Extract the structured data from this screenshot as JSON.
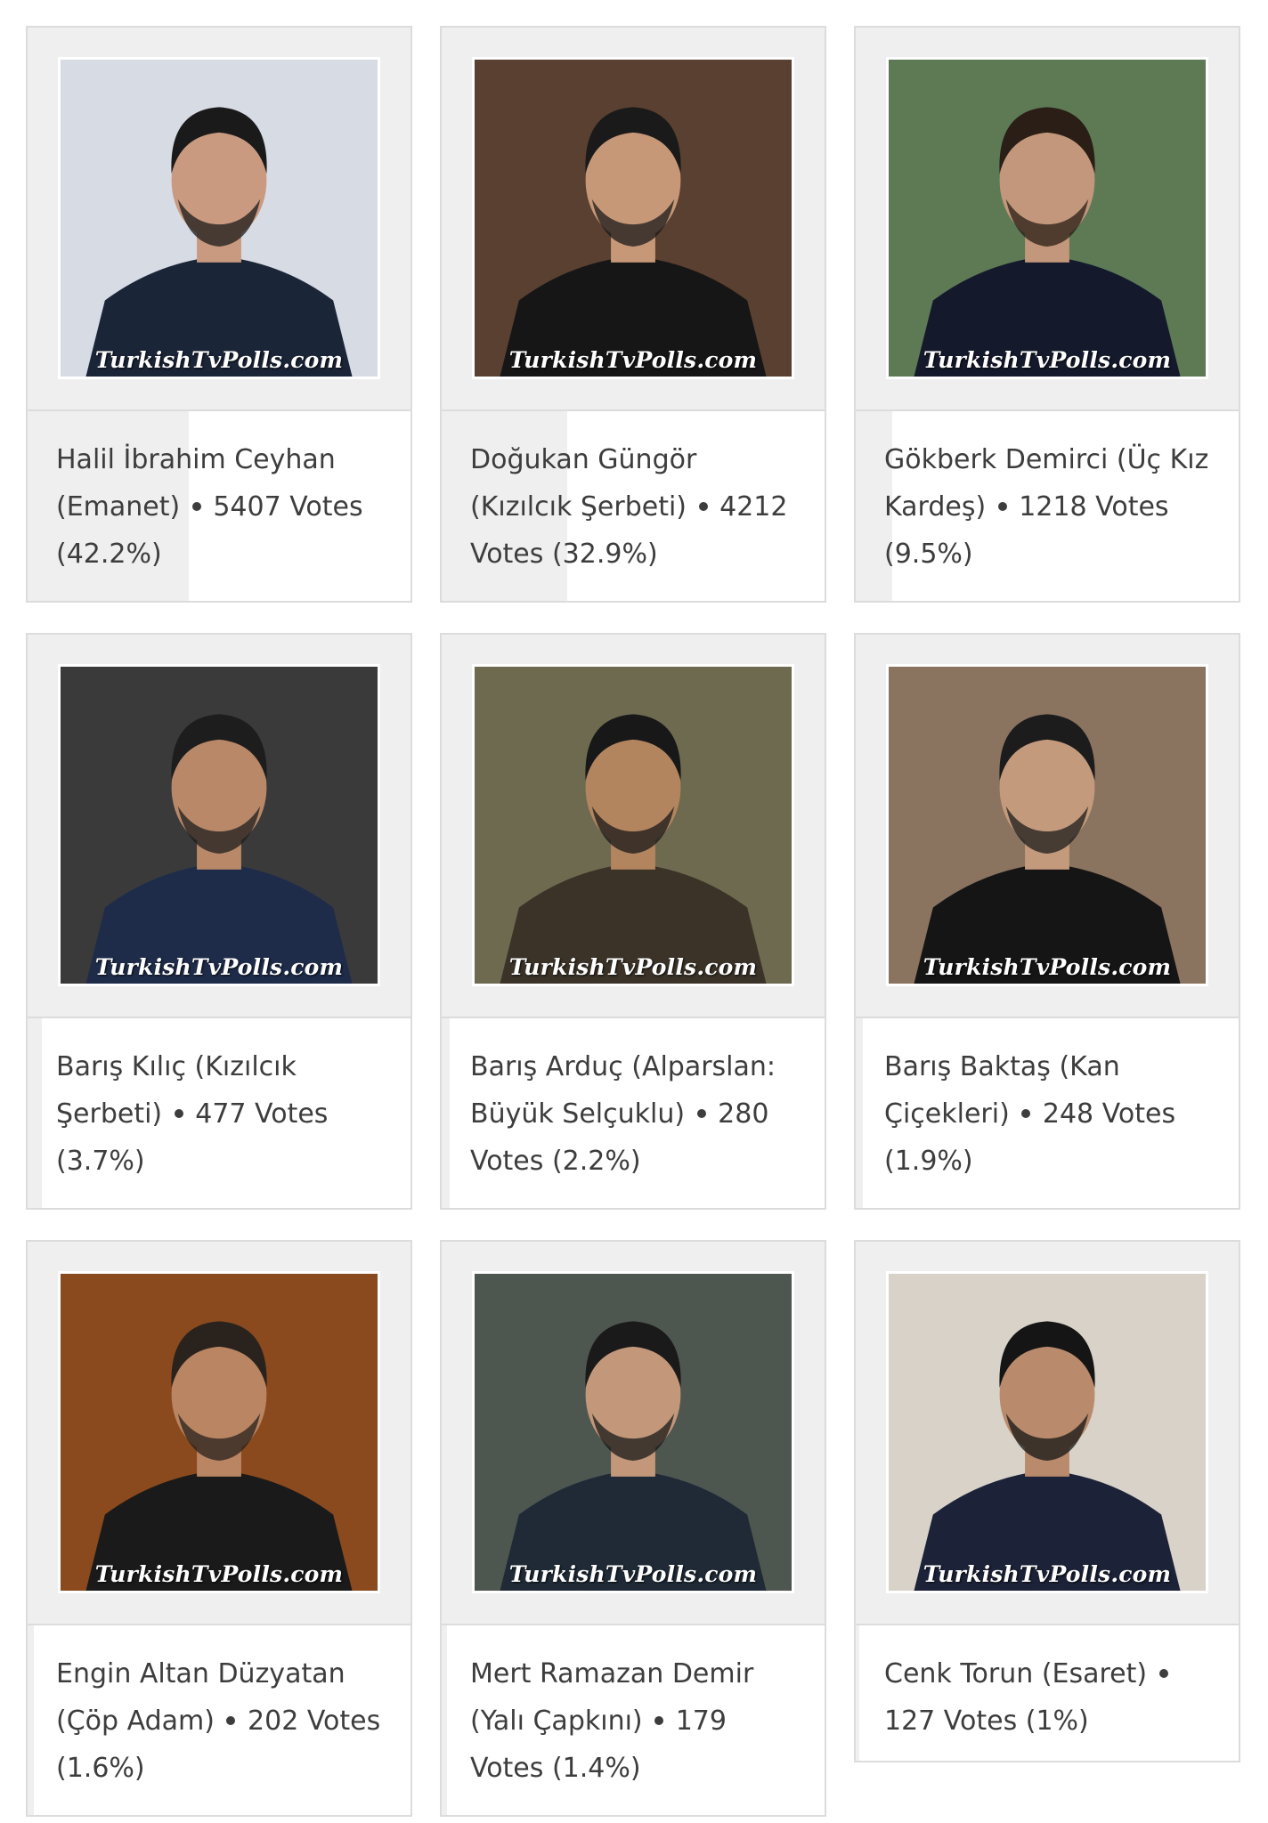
{
  "watermark": "TurkishTvPolls.com",
  "separator_icon": "bullet-dot",
  "results": [
    {
      "name": "Halil İbrahim Ceyhan",
      "show": "(Emanet)",
      "votes": "5407 Votes",
      "percent": "(42.2%)",
      "share": 0.422,
      "colors": {
        "bg": "#d6dbe4",
        "suit": "#1b2538",
        "skin": "#c99a80",
        "hair": "#1a1a1a"
      }
    },
    {
      "name": "Doğukan Güngör",
      "show": "(Kızılcık Şerbeti)",
      "votes": "4212 Votes",
      "percent": "(32.9%)",
      "share": 0.329,
      "colors": {
        "bg": "#5a4030",
        "suit": "#161616",
        "skin": "#c79877",
        "hair": "#1a1a1a"
      }
    },
    {
      "name": "Gökberk Demirci",
      "show": "(Üç Kız Kardeş)",
      "votes": "1218 Votes",
      "percent": "(9.5%)",
      "share": 0.095,
      "colors": {
        "bg": "#5d7a55",
        "suit": "#141a2c",
        "skin": "#c2977b",
        "hair": "#2a1e16"
      }
    },
    {
      "name": "Barış Kılıç",
      "show": "(Kızılcık Şerbeti)",
      "votes": "477 Votes",
      "percent": "(3.7%)",
      "share": 0.037,
      "colors": {
        "bg": "#3a3a3a",
        "suit": "#1e2c4a",
        "skin": "#b88868",
        "hair": "#1d1d1d"
      }
    },
    {
      "name": "Barış Arduç",
      "show": "(Alparslan: Büyük Selçuklu)",
      "votes": "280 Votes",
      "percent": "(2.2%)",
      "share": 0.022,
      "colors": {
        "bg": "#6e6a50",
        "suit": "#3b3328",
        "skin": "#b3855f",
        "hair": "#181818"
      }
    },
    {
      "name": "Barış Baktaş",
      "show": "(Kan Çiçekleri)",
      "votes": "248 Votes",
      "percent": "(1.9%)",
      "share": 0.019,
      "colors": {
        "bg": "#8a7460",
        "suit": "#151515",
        "skin": "#c49a7c",
        "hair": "#1c1c1c"
      }
    },
    {
      "name": "Engin Altan Düzyatan",
      "show": "(Çöp Adam)",
      "votes": "202 Votes",
      "percent": "(1.6%)",
      "share": 0.016,
      "colors": {
        "bg": "#8a4a1e",
        "suit": "#1a1a1a",
        "skin": "#b98563",
        "hair": "#2a221c"
      }
    },
    {
      "name": "Mert Ramazan Demir",
      "show": "(Yalı Çapkını)",
      "votes": "179 Votes",
      "percent": "(1.4%)",
      "share": 0.014,
      "colors": {
        "bg": "#4e5650",
        "suit": "#1f2a36",
        "skin": "#c2977a",
        "hair": "#1a1a1a"
      }
    },
    {
      "name": "Cenk Torun",
      "show": "(Esaret)",
      "votes": "127 Votes",
      "percent": "(1%)",
      "share": 0.01,
      "colors": {
        "bg": "#d8d2c8",
        "suit": "#1c2238",
        "skin": "#b98a6c",
        "hair": "#151515"
      }
    }
  ]
}
